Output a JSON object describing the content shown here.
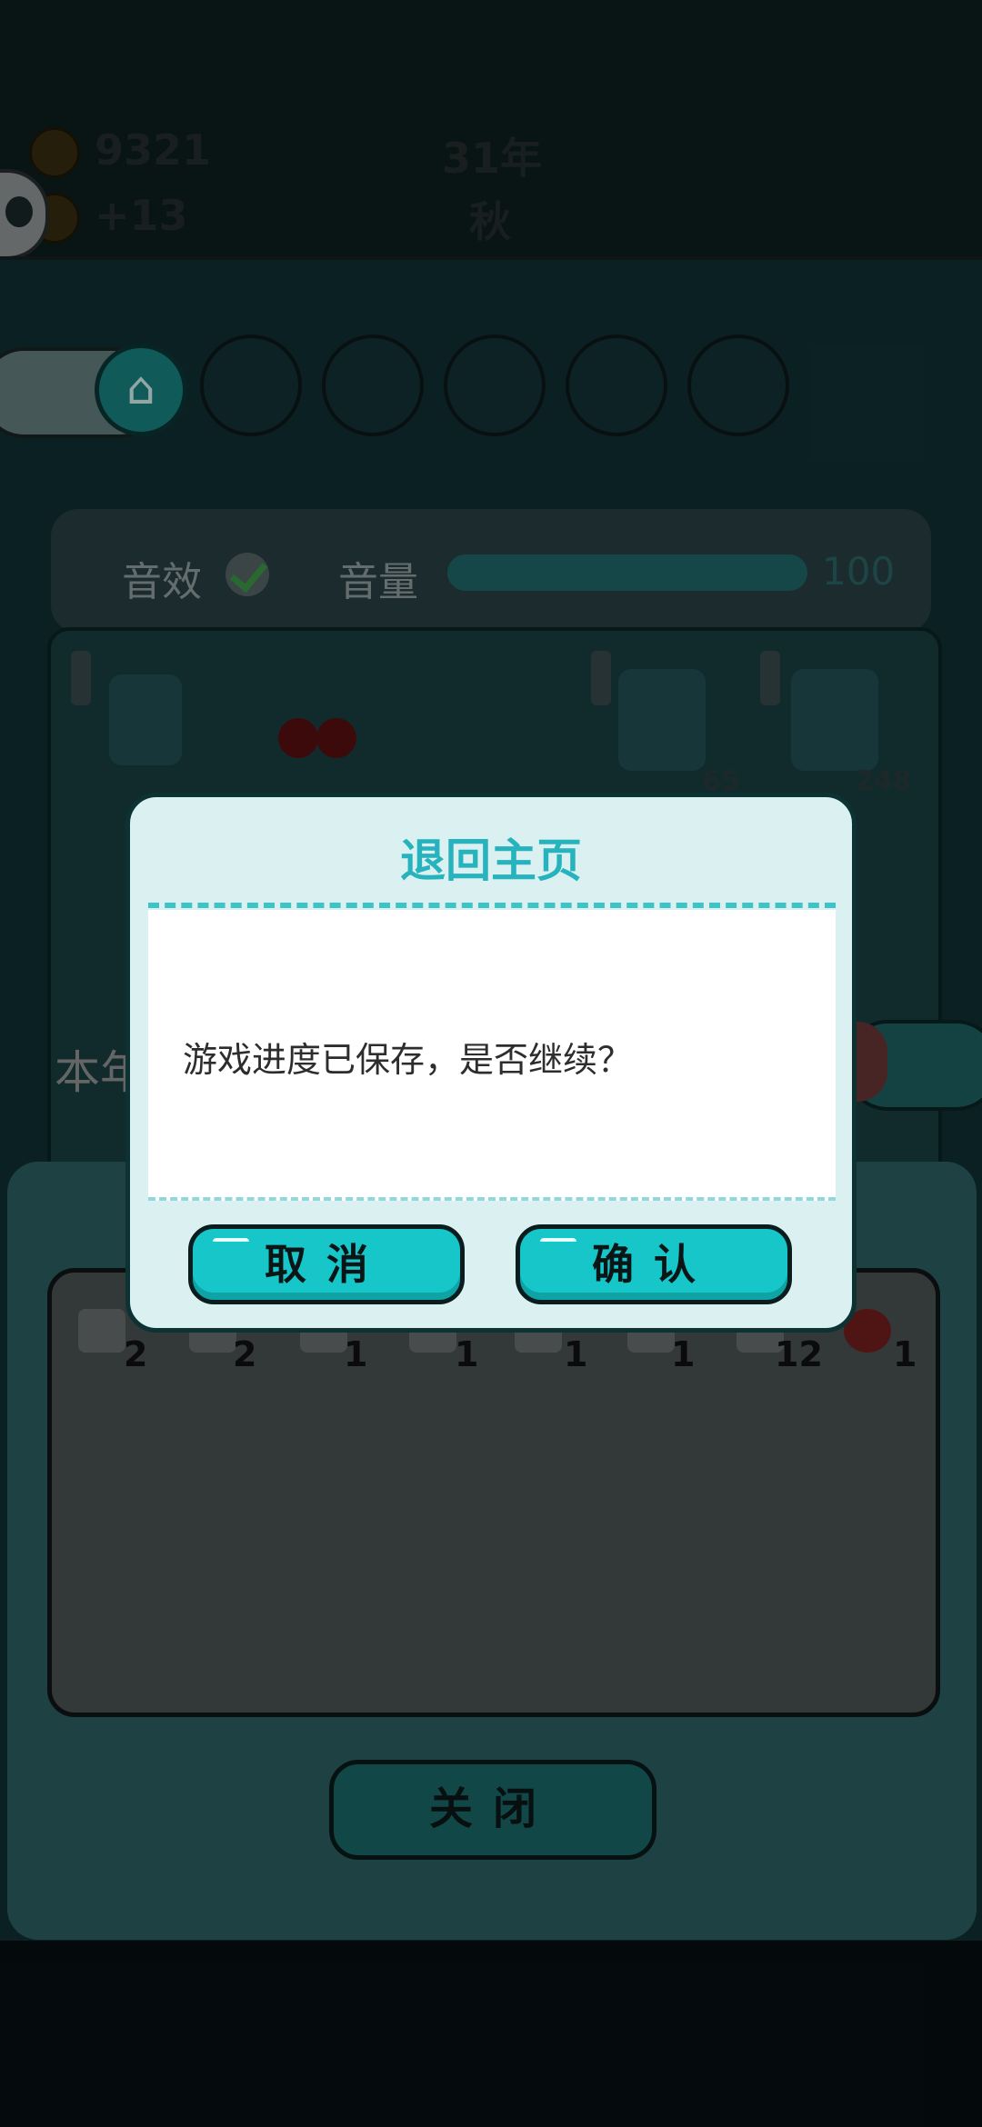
{
  "hud": {
    "coins": "9321",
    "coin_delta": "+13",
    "year": "31年",
    "season": "秋"
  },
  "settings": {
    "sound_effects_label": "音效",
    "volume_label": "音量",
    "volume_value": "100",
    "sound_effects_on": true
  },
  "background_numbers": [
    "65",
    "248"
  ],
  "year_partial_label": "本年",
  "inventory": {
    "counts": [
      "2",
      "2",
      "1",
      "1",
      "1",
      "1",
      "12",
      "1"
    ]
  },
  "close_button_label": "关闭",
  "dialog": {
    "title": "退回主页",
    "message": "游戏进度已保存，是否继续？",
    "cancel_label": "取消",
    "confirm_label": "确认"
  },
  "colors": {
    "accent": "#27b3bd",
    "button": "#16c6c9",
    "dialog_bg": "#dbf1f1"
  }
}
